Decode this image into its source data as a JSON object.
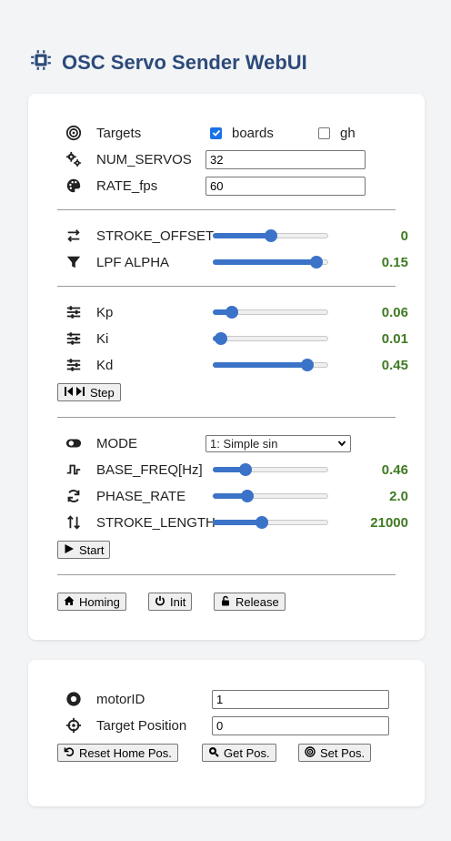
{
  "app_title": "OSC Servo Sender WebUI",
  "colors": {
    "accent": "#3b73c8",
    "value_green": "#3f7a22",
    "title_blue": "#2c4a7a"
  },
  "targets": {
    "label": "Targets",
    "options": [
      {
        "label": "boards",
        "checked": true
      },
      {
        "label": "gh",
        "checked": false
      }
    ]
  },
  "num_servos": {
    "label": "NUM_SERVOS",
    "value": "32"
  },
  "rate_fps": {
    "label": "RATE_fps",
    "value": "60"
  },
  "stroke_offset": {
    "label": "STROKE_OFFSET",
    "value": "0",
    "level": 0.5
  },
  "lpf_alpha": {
    "label": "LPF ALPHA",
    "value": "0.15",
    "level": 0.95
  },
  "kp": {
    "label": "Kp",
    "value": "0.06",
    "level": 0.12
  },
  "ki": {
    "label": "Ki",
    "value": "0.01",
    "level": 0.02
  },
  "kd": {
    "label": "Kd",
    "value": "0.45",
    "level": 0.86
  },
  "step_button": "Step",
  "mode": {
    "label": "MODE",
    "selected": "1: Simple sin"
  },
  "base_freq": {
    "label": "BASE_FREQ[Hz]",
    "value": "0.46",
    "level": 0.26
  },
  "phase_rate": {
    "label": "PHASE_RATE",
    "value": "2.0",
    "level": 0.27
  },
  "stroke_length": {
    "label": "STROKE_LENGTH",
    "value": "21000",
    "level": 0.42
  },
  "start_button": "Start",
  "homing_button": "Homing",
  "init_button": "Init",
  "release_button": "Release",
  "motor_id": {
    "label": "motorID",
    "value": "1"
  },
  "target_position": {
    "label": "Target Position",
    "value": "0"
  },
  "reset_home_button": "Reset Home Pos.",
  "get_pos_button": "Get Pos.",
  "set_pos_button": "Set Pos."
}
